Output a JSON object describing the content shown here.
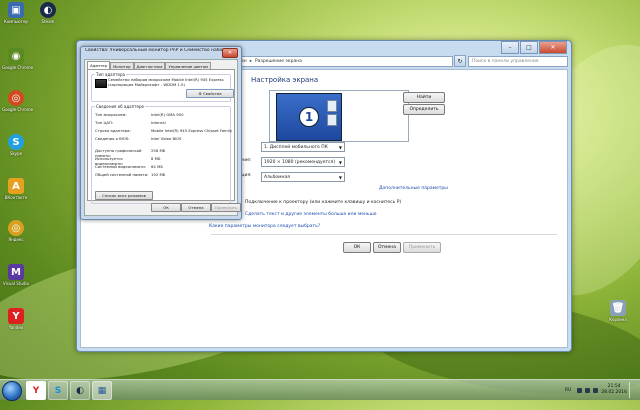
{
  "desktop": {
    "icons": [
      {
        "label": "Компьютер",
        "color": "#3a6ab0",
        "glyph": "▣"
      },
      {
        "label": "Google Chrome",
        "color": "#5a8a20",
        "glyph": "◉"
      },
      {
        "label": "Skype",
        "color": "#20a0e0",
        "glyph": "S"
      },
      {
        "label": "ВКонтакте",
        "color": "#e8a020",
        "glyph": "A"
      },
      {
        "label": "Яндекс",
        "color": "#d8a020",
        "glyph": "◎"
      },
      {
        "label": "Visual Studio",
        "color": "#5a3aa0",
        "glyph": "M"
      },
      {
        "label": "Yandex",
        "color": "#e02020",
        "glyph": "Y"
      }
    ],
    "steam_label": "Steam",
    "trash_label": "Корзина"
  },
  "control_panel": {
    "breadcrumb": [
      "Экран",
      "Разрешение экрана"
    ],
    "search_placeholder": "Поиск в панели управления",
    "heading": "Настройка экрана",
    "monitor_number": "1",
    "find_button": "Найти",
    "identify_button": "Определить",
    "display_label": "Экран:",
    "display_value": "1. Дисплей мобильного ПК",
    "resolution_label": "Разрешение:",
    "resolution_value": "1920 × 1080 (рекомендуется)",
    "orientation_label": "Ориентация:",
    "orientation_value": "Альбомная",
    "advanced_link": "Дополнительные параметры",
    "projector_text": "Подключение к проектору (или нажмите клавишу  и коснитесь P)",
    "text_size_link": "Сделать текст и другие элементы больше или меньше",
    "which_settings_link": "Какие параметры монитора следует выбрать?",
    "ok": "ОК",
    "cancel": "Отмена",
    "apply": "Применить"
  },
  "dialog": {
    "title": "Свойства: Универсальный монитор PnP и Семейство набо...",
    "tabs": [
      "Адаптер",
      "Монитор",
      "Диагностика",
      "Управление цветом"
    ],
    "adapter_type_label": "Тип адаптера",
    "adapter_name": "Семейство наборов микросхем Mobile Intel(R) 945 Express (корпорация Майкрософт - WDDM 1.0)",
    "properties_button": "Свойства",
    "adapter_info_label": "Сведения об адаптере",
    "info": [
      {
        "key": "Тип микросхем:",
        "value": "Intel(R) GMA 950"
      },
      {
        "key": "Тип ЦАП:",
        "value": "Internal"
      },
      {
        "key": "Строка адаптера:",
        "value": "Mobile Intel(R) 945 Express Chipset Family"
      },
      {
        "key": "Сведения о BIOS:",
        "value": "Intel Video BIOS"
      }
    ],
    "memory": [
      {
        "key": "Доступно графической памяти:",
        "value": "256 МБ"
      },
      {
        "key": "Используется видеопамяти:",
        "value": "8 МБ"
      },
      {
        "key": "Системной видеопамяти:",
        "value": "64 МБ"
      },
      {
        "key": "Общей системной памяти:",
        "value": "192 МБ"
      }
    ],
    "list_modes_button": "Список всех режимов",
    "ok": "ОК",
    "cancel": "Отмена",
    "apply": "Применить"
  },
  "taskbar": {
    "apps": [
      {
        "name": "yandex",
        "glyph": "Y",
        "color": "#e02020"
      },
      {
        "name": "skype",
        "glyph": "S",
        "color": "#1a90e0"
      },
      {
        "name": "steam",
        "glyph": "◐",
        "color": "#1a2a4a"
      },
      {
        "name": "control-panel",
        "glyph": "▦",
        "color": "#2a5a9a"
      }
    ],
    "language": "RU",
    "time": "21:54",
    "date": "28.02.2016"
  }
}
